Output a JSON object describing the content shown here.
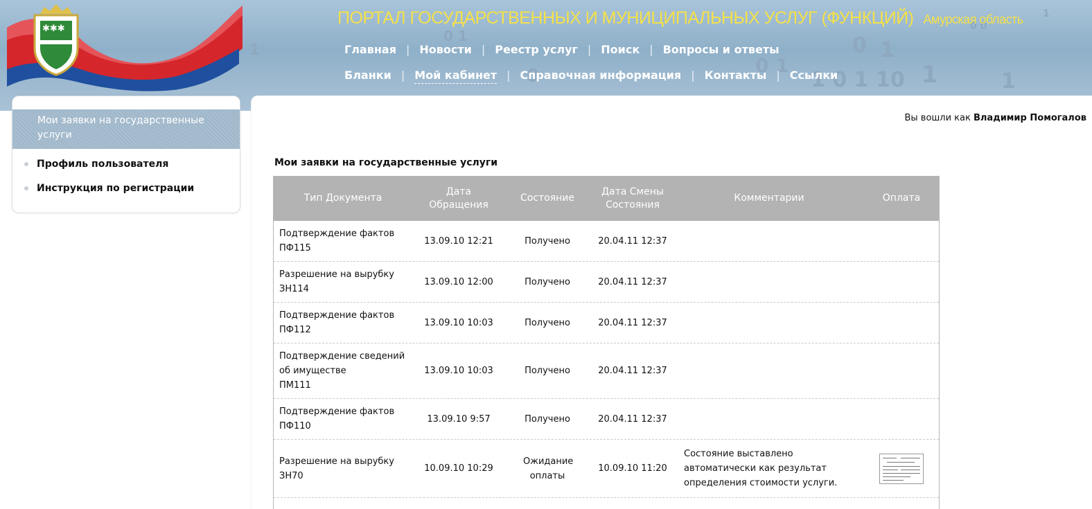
{
  "header": {
    "title": "ПОРТАЛ ГОСУДАРСТВЕННЫХ И МУНИЦИПАЛЬНЫХ УСЛУГ (ФУНКЦИЙ)",
    "region": "Амурская область",
    "nav_row1": [
      "Главная",
      "Новости",
      "Реестр услуг",
      "Поиск",
      "Вопросы и ответы"
    ],
    "nav_row2": [
      "Бланки",
      "Мой кабинет",
      "Справочная информация",
      "Контакты",
      "Ссылки"
    ],
    "active_nav": "Мой кабинет",
    "separator": "|"
  },
  "sidebar": {
    "heading": "Мои заявки на государственные услуги",
    "items": [
      "Профиль пользователя",
      "Инструкция по регистрации"
    ]
  },
  "user": {
    "prefix": "Вы вошли как",
    "name": "Владимир Помогалов"
  },
  "page": {
    "title": "Мои заявки на государственные услуги"
  },
  "table": {
    "columns": [
      "Тип Документа",
      "Дата Обращения",
      "Состояние",
      "Дата Смены Состояния",
      "Комментарии",
      "Оплата"
    ],
    "rows": [
      {
        "type_lines": [
          "Подтверждение фактов",
          "ПФ115"
        ],
        "date": "13.09.10 12:21",
        "status": "Получено",
        "changed": "20.04.11 12:37",
        "comment": "",
        "payment": false
      },
      {
        "type_lines": [
          "Разрешение на вырубку",
          "ЗН114"
        ],
        "date": "13.09.10 12:00",
        "status": "Получено",
        "changed": "20.04.11 12:37",
        "comment": "",
        "payment": false
      },
      {
        "type_lines": [
          "Подтверждение фактов",
          "ПФ112"
        ],
        "date": "13.09.10 10:03",
        "status": "Получено",
        "changed": "20.04.11 12:37",
        "comment": "",
        "payment": false
      },
      {
        "type_lines": [
          "Подтверждение сведений",
          "об имуществе",
          "ПМ111"
        ],
        "date": "13.09.10 10:03",
        "status": "Получено",
        "changed": "20.04.11 12:37",
        "comment": "",
        "payment": false
      },
      {
        "type_lines": [
          "Подтверждение фактов",
          "ПФ110"
        ],
        "date": "13.09.10 9:57",
        "status": "Получено",
        "changed": "20.04.11 12:37",
        "comment": "",
        "payment": false
      },
      {
        "type_lines": [
          "Разрешение на вырубку",
          "ЗН70"
        ],
        "date": "10.09.10 10:29",
        "status": "Ожидание оплаты",
        "changed": "10.09.10 11:20",
        "comment": "Состояние выставлено автоматически как результат определения стоимости услуги.",
        "payment": true
      }
    ]
  },
  "colors": {
    "header_bg": "#9db8ce",
    "title_yellow": "#f5e14a",
    "table_head": "#b3b3b3",
    "flag_red": "#d5262c",
    "flag_blue": "#1f4f9e",
    "emblem_green": "#2f8a3a"
  },
  "icons": {
    "payment": "payment-document-thumbnail-icon",
    "sidebar_bullet": "bullet-dot-icon"
  }
}
